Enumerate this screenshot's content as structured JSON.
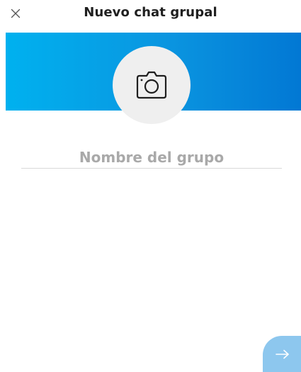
{
  "header": {
    "title": "Nuevo chat grupal",
    "close_icon": "close-icon"
  },
  "banner": {
    "gradient_start": "#00b1ef",
    "gradient_end": "#0278d4",
    "avatar_icon": "camera-icon",
    "avatar_bg": "#efefef"
  },
  "group_name": {
    "value": "",
    "placeholder": "Nombre del grupo"
  },
  "footer": {
    "next_icon": "arrow-right-icon",
    "next_button_color": "#8dc7ee"
  }
}
